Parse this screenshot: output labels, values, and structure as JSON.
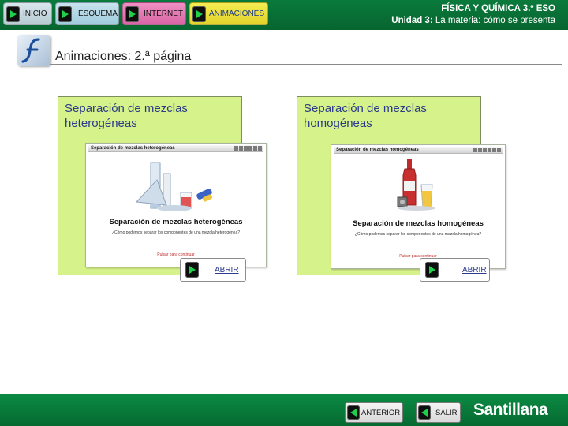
{
  "nav": {
    "inicio": "INICIO",
    "esquema": "ESQUEMA",
    "internet": "INTERNET",
    "animaciones": "ANIMACIONES"
  },
  "course": {
    "title": "FÍSICA Y QUÍMICA 3.º ESO",
    "unit_prefix": "Unidad 3:",
    "unit_name": " La materia: cómo se presenta"
  },
  "page": {
    "title": "Animaciones: 2.ª página"
  },
  "cards": [
    {
      "title_line1": "Separación de mezclas",
      "title_line2": "heterogéneas",
      "thumb_bar": "Separación de mezclas heterogéneas",
      "thumb_heading": "Separación de mezclas heterogéneas",
      "thumb_sub": "¿Cómo podemos separar los componentes de una mezcla heterogénea?",
      "thumb_continue": "Pulsar para continuar",
      "open_label": "ABRIR"
    },
    {
      "title_line1": "Separación de mezclas",
      "title_line2": "homogéneas",
      "thumb_bar": "Separación de mezclas homogéneas",
      "thumb_heading": "Separación de mezclas homogéneas",
      "thumb_sub": "¿Cómo podemos separar los componentes de una mezcla homogénea?",
      "thumb_continue": "Pulsar para continuar",
      "open_label": "ABRIR"
    }
  ],
  "footer": {
    "anterior": "ANTERIOR",
    "salir": "SALIR",
    "brand": "Santillana"
  },
  "colors": {
    "bar_green": "#07652f",
    "card_green": "#d6f28a",
    "link_blue": "#2b3a8a"
  },
  "icons": {
    "play": "play-icon",
    "flash": "flash-logo-icon"
  }
}
